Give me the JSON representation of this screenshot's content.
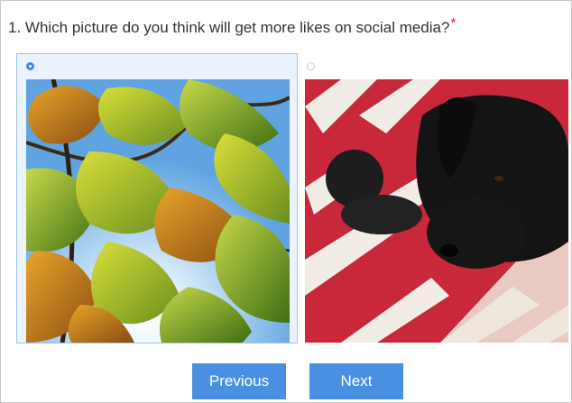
{
  "question": {
    "number_and_text": "1. Which picture do you think will get more likes on social media?",
    "required_mark": "*"
  },
  "options": [
    {
      "subject": "autumn oak leaves against blue sky",
      "selected": true
    },
    {
      "subject": "black dog resting on red and white quilt",
      "selected": false
    }
  ],
  "buttons": {
    "previous_label": "Previous",
    "next_label": "Next"
  },
  "colors": {
    "accent": "#4a90e2",
    "required": "#e02020",
    "selected_border": "#9ec3e6",
    "selected_bg": "#eaf2fb"
  }
}
